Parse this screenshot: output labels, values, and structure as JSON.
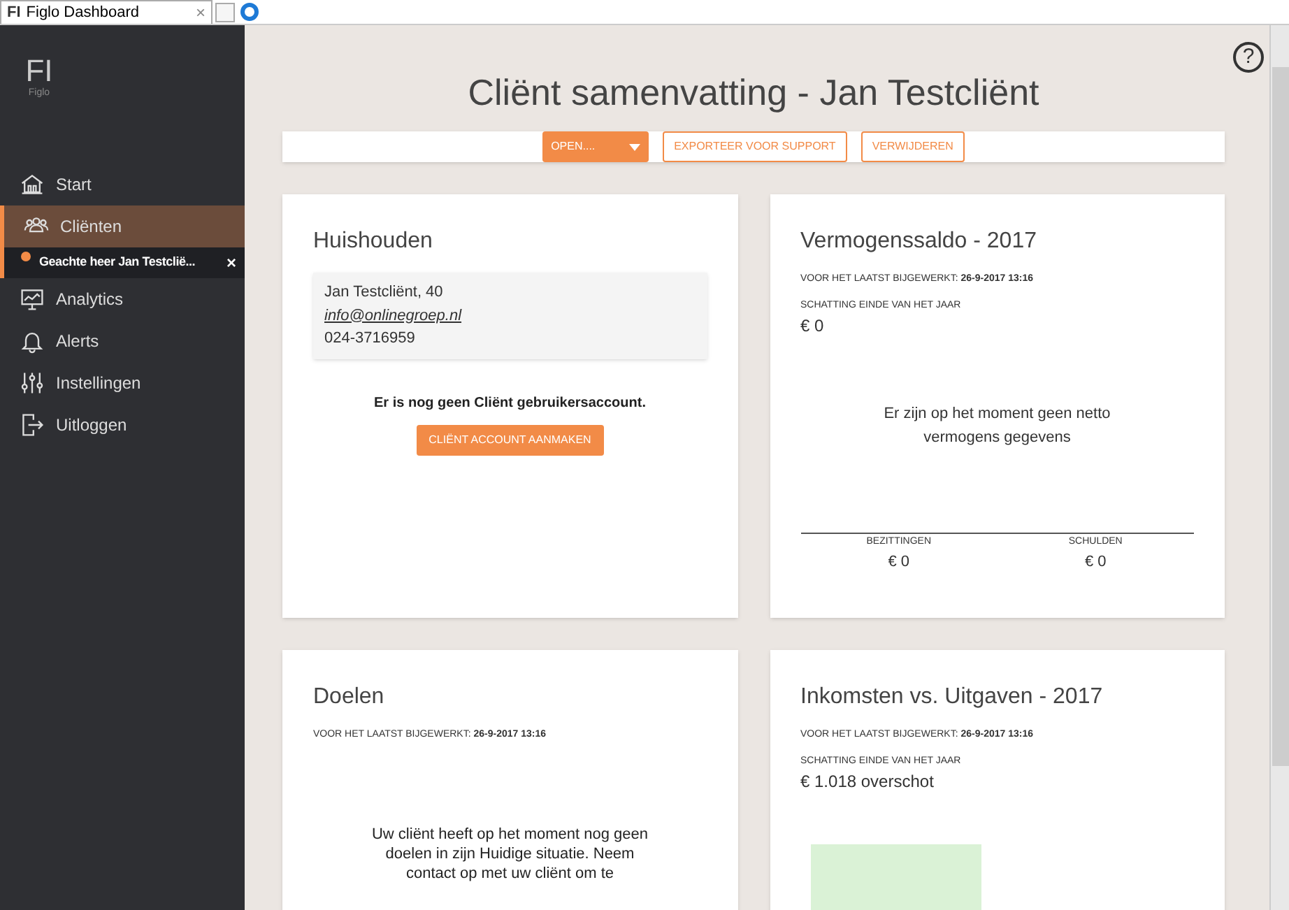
{
  "browser_tab": {
    "logo": "FI",
    "title": "Figlo Dashboard",
    "close": "×"
  },
  "sidebar": {
    "logo": "FI",
    "logo_sub": "Figlo",
    "items": [
      {
        "kind": "home",
        "label": "Start",
        "selected": false
      },
      {
        "kind": "people",
        "label": "Cliënten",
        "selected": true
      },
      {
        "kind": "client",
        "label": "Geachte heer Jan Testcliё...",
        "close": "×",
        "selected": false
      },
      {
        "kind": "chart",
        "label": "Analytics",
        "selected": false
      },
      {
        "kind": "bell",
        "label": "Alerts",
        "selected": false
      },
      {
        "kind": "sliders",
        "label": "Instellingen",
        "selected": false
      },
      {
        "kind": "logout",
        "label": "Uitloggen",
        "selected": false
      }
    ]
  },
  "page_title": "Cliënt samenvatting - Jan Testcliënt",
  "help": "?",
  "toolbar": {
    "dropdown": "OPEN....",
    "buttons": [
      "EXPORTEER VOOR SUPPORT",
      "VERWIJDEREN"
    ]
  },
  "cards": [
    {
      "kind": "household",
      "title": "Huishouden",
      "contact": {
        "name": "Jan Testcliënt, 40",
        "email": "info@onlinegroep.nl",
        "phone": "024-3716959"
      },
      "notice": "Er is nog geen Cliënt gebruikersaccount.",
      "button": "CLIËNT ACCOUNT AANMAKEN"
    },
    {
      "kind": "wealth",
      "title": "Vermogenssaldo - 2017",
      "updated_label": "VOOR HET LAATST BIJGEWERKT:",
      "updated": "26-9-2017 13:16",
      "estimate_label": "SCHATTING EINDE VAN HET JAAR",
      "estimate": "€ 0",
      "message": "Er zijn op het moment geen netto vermogens gegevens",
      "columns": [
        {
          "label": "BEZITTINGEN",
          "value": "€ 0"
        },
        {
          "label": "SCHULDEN",
          "value": "€ 0"
        }
      ]
    },
    {
      "kind": "goals",
      "title": "Doelen",
      "updated_label": "VOOR HET LAATST BIJGEWERKT:",
      "updated": "26-9-2017 13:16",
      "message": "Uw cliënt heeft op het moment nog geen doelen in zijn Huidige situatie. Neem contact op met uw cliënt om te"
    },
    {
      "kind": "income",
      "title": "Inkomsten vs. Uitgaven - 2017",
      "updated_label": "VOOR HET LAATST BIJGEWERKT:",
      "updated": "26-9-2017 13:16",
      "estimate_label": "SCHATTING EINDE VAN HET JAAR",
      "estimate": "€ 1.018 overschot"
    }
  ]
}
